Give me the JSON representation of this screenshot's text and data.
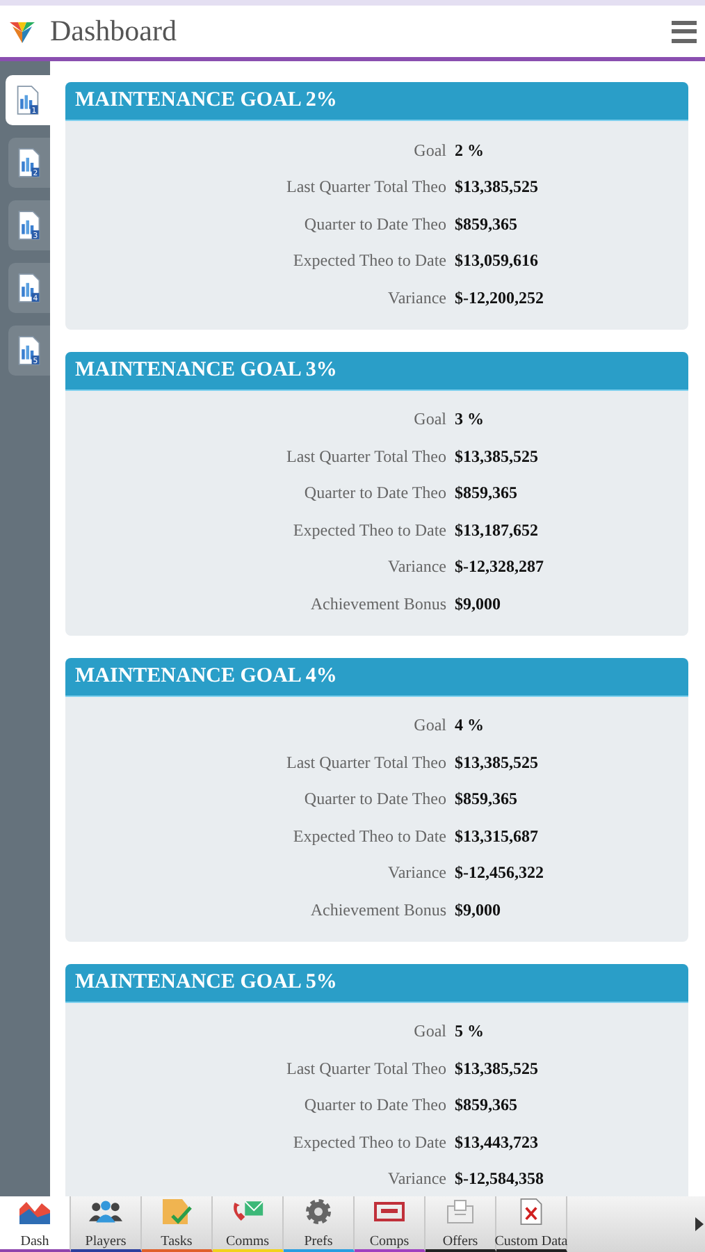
{
  "header": {
    "title": "Dashboard"
  },
  "sidebar": {
    "items": [
      {
        "label": "1",
        "selected": true
      },
      {
        "label": "2",
        "selected": false
      },
      {
        "label": "3",
        "selected": false
      },
      {
        "label": "4",
        "selected": false
      },
      {
        "label": "5",
        "selected": false
      }
    ]
  },
  "cards": [
    {
      "title": "MAINTENANCE GOAL 2%",
      "rows": [
        {
          "label": "Goal",
          "value": "2 %"
        },
        {
          "label": "Last Quarter Total Theo",
          "value": "$13,385,525"
        },
        {
          "label": "Quarter to Date Theo",
          "value": "$859,365"
        },
        {
          "label": "Expected Theo to Date",
          "value": "$13,059,616"
        },
        {
          "label": "Variance",
          "value": "$-12,200,252"
        }
      ]
    },
    {
      "title": "MAINTENANCE GOAL 3%",
      "rows": [
        {
          "label": "Goal",
          "value": "3 %"
        },
        {
          "label": "Last Quarter Total Theo",
          "value": "$13,385,525"
        },
        {
          "label": "Quarter to Date Theo",
          "value": "$859,365"
        },
        {
          "label": "Expected Theo to Date",
          "value": "$13,187,652"
        },
        {
          "label": "Variance",
          "value": "$-12,328,287"
        },
        {
          "label": "Achievement Bonus",
          "value": "$9,000"
        }
      ]
    },
    {
      "title": "MAINTENANCE GOAL 4%",
      "rows": [
        {
          "label": "Goal",
          "value": "4 %"
        },
        {
          "label": "Last Quarter Total Theo",
          "value": "$13,385,525"
        },
        {
          "label": "Quarter to Date Theo",
          "value": "$859,365"
        },
        {
          "label": "Expected Theo to Date",
          "value": "$13,315,687"
        },
        {
          "label": "Variance",
          "value": "$-12,456,322"
        },
        {
          "label": "Achievement Bonus",
          "value": "$9,000"
        }
      ]
    },
    {
      "title": "MAINTENANCE GOAL 5%",
      "rows": [
        {
          "label": "Goal",
          "value": "5 %"
        },
        {
          "label": "Last Quarter Total Theo",
          "value": "$13,385,525"
        },
        {
          "label": "Quarter to Date Theo",
          "value": "$859,365"
        },
        {
          "label": "Expected Theo to Date",
          "value": "$13,443,723"
        },
        {
          "label": "Variance",
          "value": "$-12,584,358"
        }
      ]
    }
  ],
  "tabbar": {
    "tabs": [
      {
        "label": "Dash",
        "kind": "dash",
        "color": "#8e44ad",
        "selected": true
      },
      {
        "label": "Players",
        "kind": "players",
        "color": "#2c3e9e",
        "selected": false
      },
      {
        "label": "Tasks",
        "kind": "tasks",
        "color": "#e0602a",
        "selected": false
      },
      {
        "label": "Comms",
        "kind": "comms",
        "color": "#f1d21c",
        "selected": false
      },
      {
        "label": "Prefs",
        "kind": "prefs",
        "color": "#2a9ee0",
        "selected": false
      },
      {
        "label": "Comps",
        "kind": "comps",
        "color": "#a040c0",
        "selected": false
      },
      {
        "label": "Offers",
        "kind": "offers",
        "color": "#222222",
        "selected": false
      },
      {
        "label": "Custom Data",
        "kind": "custom",
        "color": "#222222",
        "selected": false
      }
    ]
  }
}
